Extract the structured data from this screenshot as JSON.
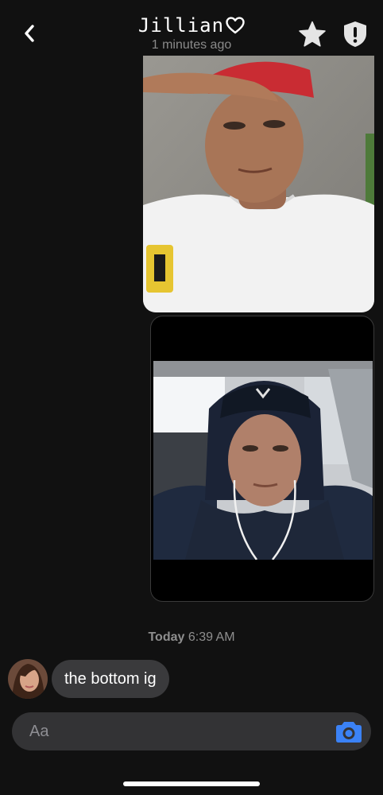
{
  "header": {
    "contact_name": "Jillian",
    "status": "1 minutes ago",
    "heart_icon": "heart-outline-icon",
    "back_icon": "chevron-left-icon",
    "star_icon": "star-icon",
    "shield_icon": "shield-alert-icon"
  },
  "messages": {
    "photos": [
      "sent-photo-red-cap-selfie",
      "sent-photo-hoodie-car-selfie"
    ],
    "timestamp_day": "Today",
    "timestamp_time": "6:39 AM",
    "received_text": "the bottom ig"
  },
  "composer": {
    "placeholder": "Aa",
    "camera_icon": "camera-icon"
  },
  "colors": {
    "background": "#111111",
    "bubble": "#3a3a3c",
    "input": "#333335",
    "accent": "#3b82f6",
    "muted": "#8e8e93"
  }
}
